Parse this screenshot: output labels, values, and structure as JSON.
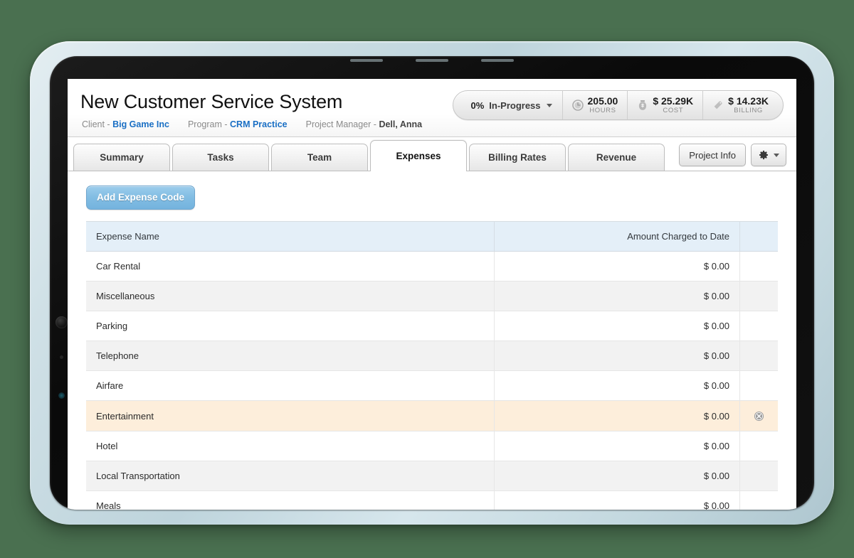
{
  "header": {
    "title": "New Customer Service System",
    "meta": [
      {
        "label": "Client - ",
        "value": "Big Game Inc",
        "style": "link"
      },
      {
        "label": "Program - ",
        "value": "CRM Practice",
        "style": "link"
      },
      {
        "label": "Project Manager - ",
        "value": "Dell, Anna",
        "style": "strong"
      }
    ]
  },
  "status_pill": {
    "percent": "0%",
    "status": "In-Progress",
    "stats": [
      {
        "icon": "clock-icon",
        "value": "205.00",
        "label": "HOURS"
      },
      {
        "icon": "money-bag-icon",
        "value": "$ 25.29K",
        "label": "COST"
      },
      {
        "icon": "tag-icon",
        "value": "$ 14.23K",
        "label": "BILLING"
      }
    ]
  },
  "tabs": [
    {
      "label": "Summary",
      "active": false
    },
    {
      "label": "Tasks",
      "active": false
    },
    {
      "label": "Team",
      "active": false
    },
    {
      "label": "Expenses",
      "active": true
    },
    {
      "label": "Billing Rates",
      "active": false
    },
    {
      "label": "Revenue",
      "active": false
    }
  ],
  "toolbar": {
    "project_info_label": "Project Info",
    "gear_icon": "gear-icon",
    "add_expense_label": "Add Expense Code"
  },
  "table": {
    "columns": [
      "Expense Name",
      "Amount Charged to Date",
      ""
    ],
    "rows": [
      {
        "name": "Car Rental",
        "amount": "$ 0.00",
        "selected": false
      },
      {
        "name": "Miscellaneous",
        "amount": "$ 0.00",
        "selected": false
      },
      {
        "name": "Parking",
        "amount": "$ 0.00",
        "selected": false
      },
      {
        "name": "Telephone",
        "amount": "$ 0.00",
        "selected": false
      },
      {
        "name": "Airfare",
        "amount": "$ 0.00",
        "selected": false
      },
      {
        "name": "Entertainment",
        "amount": "$ 0.00",
        "selected": true
      },
      {
        "name": "Hotel",
        "amount": "$ 0.00",
        "selected": false
      },
      {
        "name": "Local Transportation",
        "amount": "$ 0.00",
        "selected": false
      },
      {
        "name": "Meals",
        "amount": "$ 0.00",
        "selected": false
      }
    ],
    "delete_icon": "delete-circle-icon"
  },
  "colors": {
    "background": "#4a7050",
    "accent_button": "#82bde3",
    "link": "#1a6fc4",
    "header_row": "#e4eff8",
    "selected_row": "#fdeedb"
  }
}
